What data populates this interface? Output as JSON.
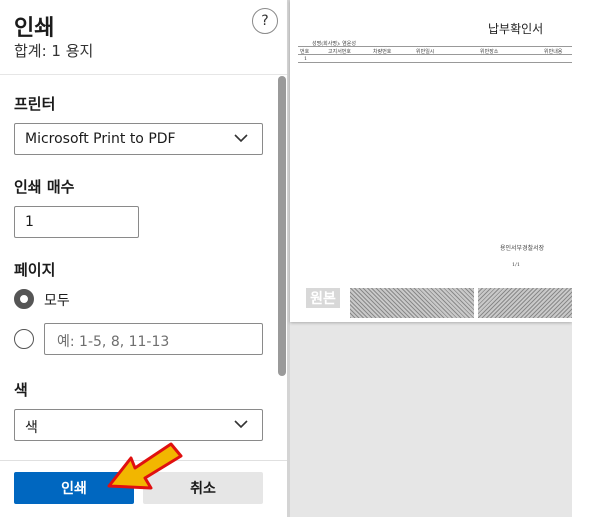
{
  "header": {
    "title": "인쇄",
    "subtitle": "합계: 1 용지",
    "help_label": "?"
  },
  "printer": {
    "label": "프린터",
    "selected": "Microsoft Print to PDF"
  },
  "copies": {
    "label": "인쇄 매수",
    "value": "1"
  },
  "pages": {
    "label": "페이지",
    "all_label": "모두",
    "range_placeholder": "예: 1-5, 8, 11-13",
    "selected": "all"
  },
  "color": {
    "label": "색",
    "selected": "색"
  },
  "footer": {
    "print_label": "인쇄",
    "cancel_label": "취소"
  },
  "preview": {
    "doc_title": "납부확인서",
    "meta_line": "성명(회사명):    염윤성",
    "columns": [
      "번호",
      "고지서번호",
      "차량번호",
      "위반일시",
      "위반장소",
      "위반내용"
    ],
    "row_number": "1",
    "issuer": "용인서부경찰서장",
    "page_indicator": "1/1",
    "stamp_text": "원본"
  },
  "colors": {
    "primary": "#0067c0",
    "arrow_fill": "#f2b600",
    "arrow_stroke": "#e01010"
  }
}
